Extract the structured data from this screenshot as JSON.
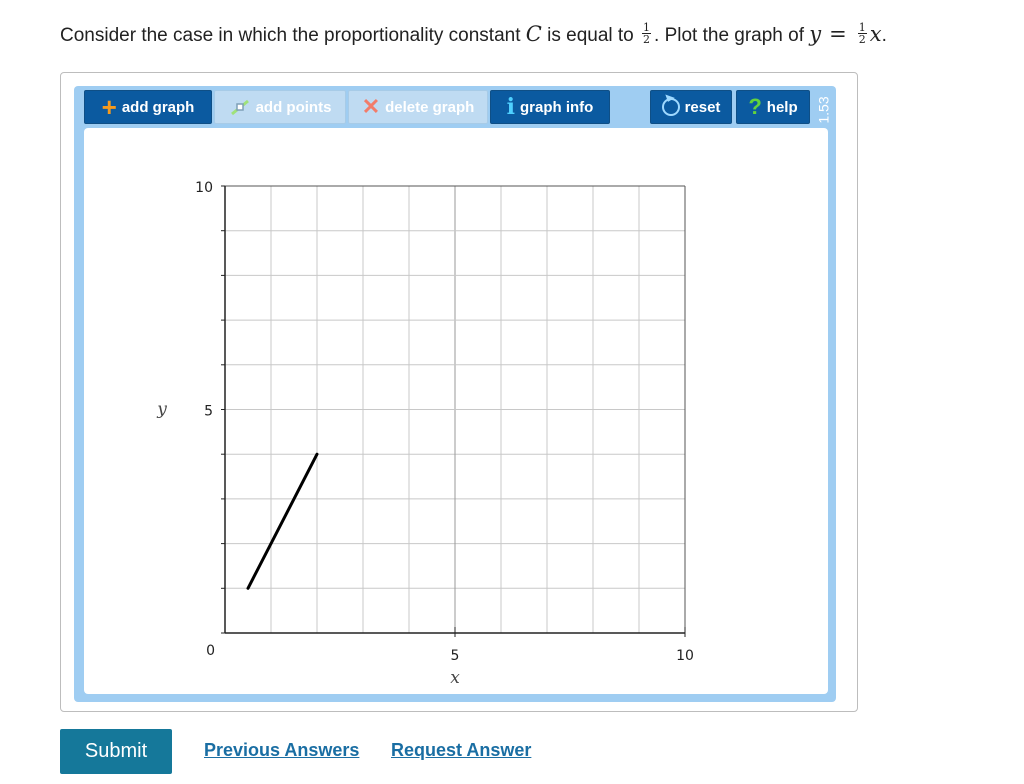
{
  "question": {
    "part1": "Consider the case in which the proportionality constant ",
    "const_symbol": "C",
    "part2": " is equal to ",
    "frac_num": "1",
    "frac_den": "2",
    "part3": ". Plot the graph of ",
    "y_symbol": "y",
    "equals": "=",
    "x_symbol": "x",
    "end": "."
  },
  "toolbar": {
    "add_graph": "add graph",
    "add_points": "add points",
    "delete_graph": "delete graph",
    "graph_info": "graph info",
    "reset": "reset",
    "help": "help",
    "version": "1.53"
  },
  "graph": {
    "x_axis_label": "x",
    "y_axis_label": "y",
    "x_ticks": [
      "5",
      "10"
    ],
    "y_ticks": [
      "10",
      "5",
      "0"
    ],
    "xlim": [
      0,
      10
    ],
    "ylim": [
      0,
      10
    ],
    "grid": true,
    "segment": {
      "x1": 0.5,
      "y1": 1,
      "x2": 2,
      "y2": 4
    },
    "line_color": "#000000"
  },
  "footer": {
    "submit": "Submit",
    "previous_answers": "Previous Answers",
    "request_answer": "Request Answer"
  },
  "colors": {
    "toolbar_active": "#0b5aa0",
    "toolbar_disabled": "#bfdbf2",
    "frame": "#9fcdf2",
    "submit": "#15789a",
    "link": "#1a6ea3"
  }
}
